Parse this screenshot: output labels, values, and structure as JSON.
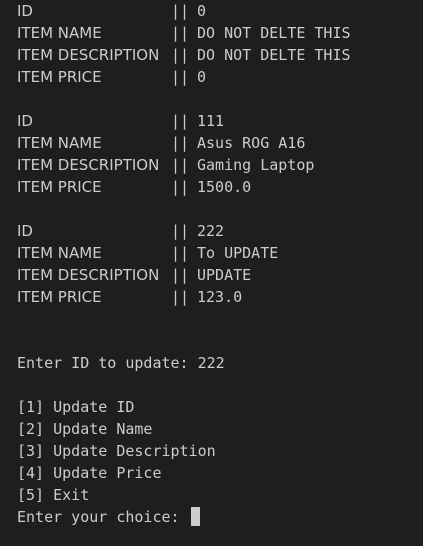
{
  "records": [
    {
      "id_label": "ID",
      "id": "0",
      "name_label": "ITEM NAME",
      "name": "DO NOT DELTE THIS",
      "desc_label": "ITEM DESCRIPTION",
      "desc": "DO NOT DELTE THIS",
      "price_label": "ITEM PRICE",
      "price": "0"
    },
    {
      "id_label": "ID",
      "id": "111",
      "name_label": "ITEM NAME",
      "name": "Asus ROG A16",
      "desc_label": "ITEM DESCRIPTION",
      "desc": "Gaming Laptop",
      "price_label": "ITEM PRICE",
      "price": "1500.0"
    },
    {
      "id_label": "ID",
      "id": "222",
      "name_label": "ITEM NAME",
      "name": "To UPDATE",
      "desc_label": "ITEM DESCRIPTION",
      "desc": "UPDATE",
      "price_label": "ITEM PRICE",
      "price": "123.0"
    }
  ],
  "separator": "||",
  "prompt_update": "Enter ID to update: 222",
  "menu": [
    "[1] Update ID",
    "[2] Update Name",
    "[3] Update Description",
    "[4] Update Price",
    "[5] Exit"
  ],
  "choice_prompt": "Enter your choice: "
}
